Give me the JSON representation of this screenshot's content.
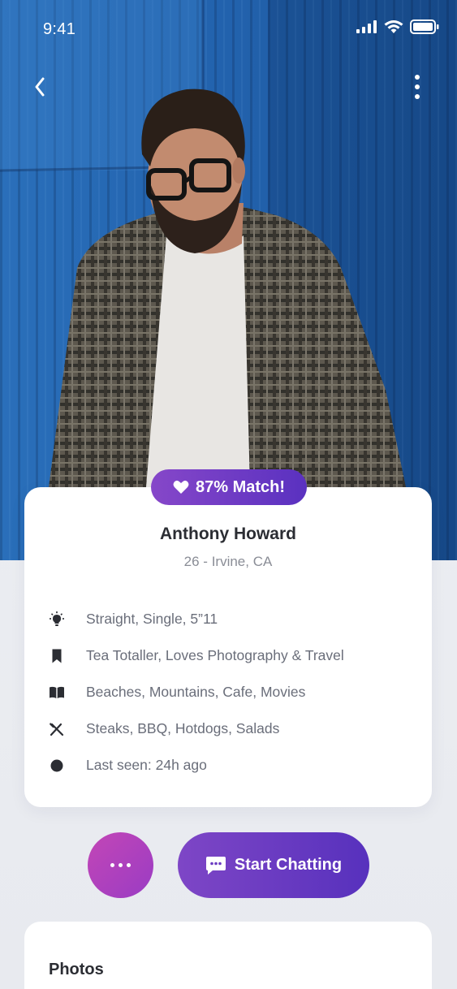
{
  "status_bar": {
    "time": "9:41"
  },
  "profile": {
    "match_label": "87% Match!",
    "name": "Anthony Howard",
    "subtitle": "26 - Irvine, CA",
    "details": [
      {
        "icon": "lightbulb-icon",
        "text": "Straight, Single, 5”11"
      },
      {
        "icon": "bookmark-icon",
        "text": "Tea Totaller, Loves Photography & Travel"
      },
      {
        "icon": "book-icon",
        "text": "Beaches, Mountains, Cafe, Movies"
      },
      {
        "icon": "utensils-icon",
        "text": "Steaks, BBQ, Hotdogs, Salads"
      },
      {
        "icon": "status-dot-icon",
        "text": "Last seen: 24h ago"
      }
    ]
  },
  "actions": {
    "chat_label": "Start Chatting"
  },
  "photos": {
    "title": "Photos"
  },
  "colors": {
    "accent_start": "#8647c9",
    "accent_end": "#5731bd",
    "more_start": "#c346b6",
    "text_dark": "#2b2d33",
    "text_muted": "#6a6e7a"
  }
}
